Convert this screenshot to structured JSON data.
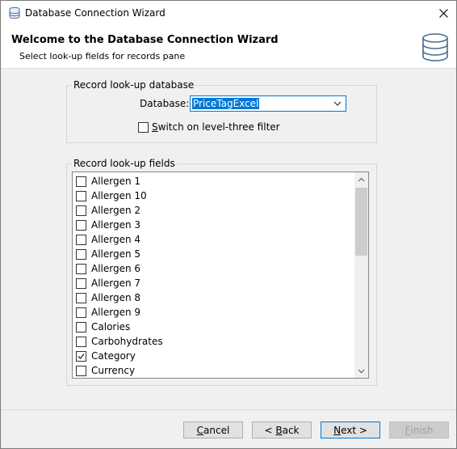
{
  "window": {
    "title": "Database Connection Wizard",
    "close_glyph": "✕"
  },
  "header": {
    "title": "Welcome to the Database Connection Wizard",
    "subtitle": "Select look-up fields for records pane"
  },
  "lookup_database": {
    "legend": "Record look-up database",
    "database_label": "Database:",
    "database_value": "PriceTagExcel",
    "filter_label_first": "S",
    "filter_label_rest": "witch on level-three filter",
    "filter_checked": false
  },
  "lookup_fields": {
    "legend": "Record look-up fields",
    "items": [
      {
        "label": "Allergen 1",
        "checked": false
      },
      {
        "label": "Allergen 10",
        "checked": false
      },
      {
        "label": "Allergen 2",
        "checked": false
      },
      {
        "label": "Allergen 3",
        "checked": false
      },
      {
        "label": "Allergen 4",
        "checked": false
      },
      {
        "label": "Allergen 5",
        "checked": false
      },
      {
        "label": "Allergen 6",
        "checked": false
      },
      {
        "label": "Allergen 7",
        "checked": false
      },
      {
        "label": "Allergen 8",
        "checked": false
      },
      {
        "label": "Allergen 9",
        "checked": false
      },
      {
        "label": "Calories",
        "checked": false
      },
      {
        "label": "Carbohydrates",
        "checked": false
      },
      {
        "label": "Category",
        "checked": true
      },
      {
        "label": "Currency",
        "checked": false
      }
    ]
  },
  "buttons": {
    "cancel": {
      "mnemonic": "C",
      "rest": "ancel"
    },
    "back": {
      "prefix": "< ",
      "mnemonic": "B",
      "rest": "ack"
    },
    "next": {
      "mnemonic": "N",
      "rest": "ext >"
    },
    "finish": {
      "mnemonic": "F",
      "rest": "inish"
    }
  },
  "colors": {
    "accent": "#0078d7",
    "window_bg": "#f0f0f0",
    "header_bg": "#ffffff"
  }
}
